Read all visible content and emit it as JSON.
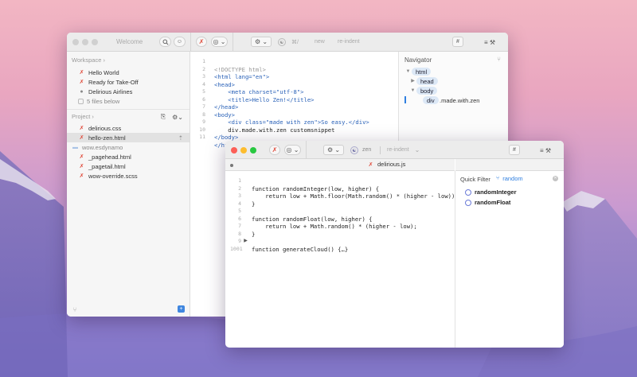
{
  "welcome": {
    "title": "Welcome",
    "workspace_label": "Workspace",
    "workspace_items": [
      "Hello World",
      "Ready for Take-Off",
      "Delirious Airlines"
    ],
    "files_below": "5 files below",
    "project_label": "Project",
    "files": [
      "delirious.css",
      "hello-zen.html",
      "wow.esdynamo",
      "_pagehead.html",
      "_pagetail.html",
      "wow-override.scss"
    ],
    "toolbar": {
      "hint1": "⌘/",
      "hint2": "new",
      "hint3": "re-indent",
      "hash": "#"
    },
    "navigator": {
      "title": "Navigator",
      "nodes": [
        "html",
        "head",
        "body",
        "div"
      ],
      "div_suffix": ".made.with.zen"
    },
    "code_lines": [
      "<!DOCTYPE html>",
      "<html lang=\"en\">",
      "<head>",
      "    <meta charset=\"utf-8\">",
      "    <title>Hello Zen!</title>",
      "</head>",
      "<body>",
      "    <div class=\"made with zen\">So easy.</div>",
      "    div.made.with.zen customsnippet",
      "</body>",
      "</html>"
    ],
    "line_numbers": [
      "1",
      "2",
      "3",
      "4",
      "5",
      "6",
      "7",
      "8",
      "9",
      "10",
      "11"
    ]
  },
  "editor": {
    "tab": "delirious.js",
    "toolbar": {
      "mode": "zen",
      "hint": "re-indent",
      "hash": "#"
    },
    "code_lines": [
      "function randomInteger(low, higher) {",
      "    return low + Math.floor(Math.random() * (higher - low));",
      "}",
      "",
      "function randomFloat(low, higher) {",
      "    return low + Math.random() * (higher - low);",
      "}",
      "",
      "function generateCloud() {…}"
    ],
    "line_numbers": [
      "1",
      "2",
      "3",
      "4",
      "5",
      "6",
      "7",
      "8",
      "9",
      "1001"
    ],
    "quick_filter": {
      "label": "Quick Filter",
      "value": "random",
      "results": [
        "randomInteger",
        "randomFloat"
      ]
    }
  },
  "colors": {
    "accent": "#2f7fe0",
    "close": "#fc5f57",
    "min": "#fdbd2e",
    "max": "#28c840"
  }
}
